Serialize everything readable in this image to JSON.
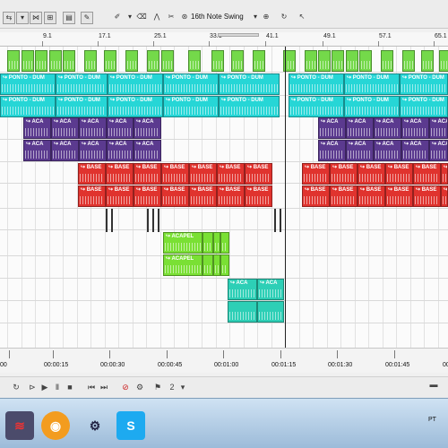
{
  "toolbar": {
    "swing_label": "16th Note Swing",
    "buttons": [
      "select",
      "envelope",
      "edit",
      "move",
      "snap",
      "pencil",
      "brush",
      "eraser",
      "fade",
      "swing"
    ]
  },
  "ruler": {
    "labels": [
      "9.1",
      "17.1",
      "25.1",
      "33.1",
      "41.1",
      "49.1",
      "57.1",
      "65.1"
    ]
  },
  "time_ruler": {
    "labels": [
      "00",
      "00:00:15",
      "00:00:30",
      "00:00:45",
      "00:01:00",
      "00:01:15",
      "00:01:30",
      "00:01:45",
      "00"
    ]
  },
  "clips": {
    "ponto": "PONTO - DUM",
    "acai": "ACA",
    "base": "BASE",
    "acapel": "ACAPEL",
    "acapel_short": "ACA"
  },
  "colors": {
    "green": "#74d94a",
    "cyan": "#26d6d6",
    "purple": "#5b3a8f",
    "red": "#e0332e",
    "lime": "#7ae034",
    "teal": "#2dcfb6"
  },
  "taskbar": {
    "locale": "PT",
    "apps": [
      "audio-app",
      "firefox",
      "editor",
      "skype"
    ]
  }
}
